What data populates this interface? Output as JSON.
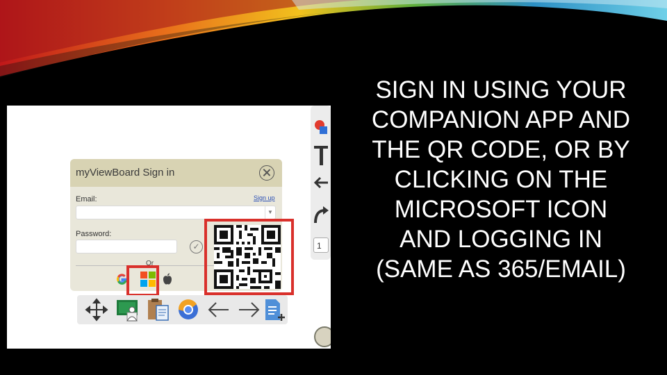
{
  "slide": {
    "title_lines": [
      "SIGN IN USING YOUR",
      "COMPANION APP AND",
      "THE QR CODE, OR BY",
      "CLICKING ON THE",
      "MICROSOFT ICON",
      "AND LOGGING IN",
      "(SAME AS 365/EMAIL)"
    ]
  },
  "signin_dialog": {
    "title": "myViewBoard Sign in",
    "email_label": "Email:",
    "signup_link": "Sign up",
    "email_value": "",
    "password_label": "Password:",
    "password_value": "",
    "or_text": "Or",
    "providers": [
      "google-icon",
      "microsoft-icon",
      "apple-icon"
    ]
  },
  "highlights": [
    "microsoft-icon",
    "qr-code"
  ],
  "bottom_toolbar": {
    "icons": [
      "move-icon",
      "classroom-icon",
      "clipboard-document-icon",
      "browser-icon",
      "arrow-left-icon",
      "arrow-right-icon",
      "add-page-icon"
    ]
  },
  "right_toolbar": {
    "page_number": "1",
    "icons": [
      "shapes-icon",
      "text-tool-icon",
      "undo-icon",
      "redo-icon"
    ]
  },
  "colors": {
    "highlight": "#d9302b",
    "dialog_header": "#d8d3b3",
    "dialog_body": "#e9e7da",
    "slide_background": "#000000",
    "slide_text": "#ffffff"
  }
}
